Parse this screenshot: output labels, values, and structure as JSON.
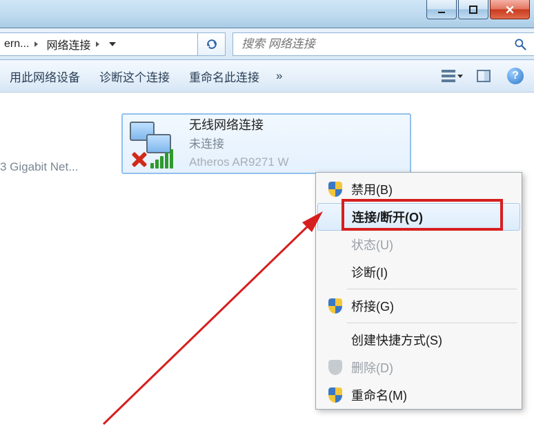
{
  "breadcrumb": {
    "crumb1": "ern...",
    "crumb2": "网络连接"
  },
  "search": {
    "placeholder": "搜索 网络连接"
  },
  "toolbar": {
    "use_device": "用此网络设备",
    "diagnose": "诊断这个连接",
    "rename": "重命名此连接",
    "overflow": "»"
  },
  "left_adapter_text": "3 Gigabit Net...",
  "adapter": {
    "name": "无线网络连接",
    "status": "未连接",
    "device": "Atheros AR9271 W"
  },
  "context_menu": {
    "disable": "禁用(B)",
    "connect_disconnect": "连接/断开(O)",
    "status": "状态(U)",
    "diagnose": "诊断(I)",
    "bridge": "桥接(G)",
    "create_shortcut": "创建快捷方式(S)",
    "delete": "删除(D)",
    "rename": "重命名(M)"
  }
}
